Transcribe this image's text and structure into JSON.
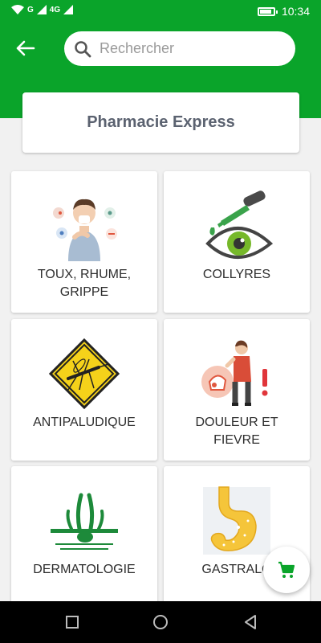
{
  "status_bar": {
    "network_1": "G",
    "network_2": "4G",
    "time": "10:34",
    "battery_level": 0.85
  },
  "header": {
    "search": {
      "placeholder": "Rechercher"
    }
  },
  "pharmacy": {
    "name": "Pharmacie Express"
  },
  "categories": [
    {
      "label": "TOUX, RHUME,\nGRIPPE",
      "icon": "sick-person-icon"
    },
    {
      "label": "COLLYRES",
      "icon": "eye-drops-icon"
    },
    {
      "label": "ANTIPALUDIQUE",
      "icon": "mosquito-sign-icon"
    },
    {
      "label": "DOULEUR ET\nFIEVRE",
      "icon": "pain-person-icon"
    },
    {
      "label": "DERMATOLOGIE",
      "icon": "skin-hair-icon"
    },
    {
      "label": "GASTRALO",
      "icon": "stomach-icon"
    }
  ],
  "colors": {
    "primary": "#0aa42a",
    "background": "#f1f1f1"
  }
}
